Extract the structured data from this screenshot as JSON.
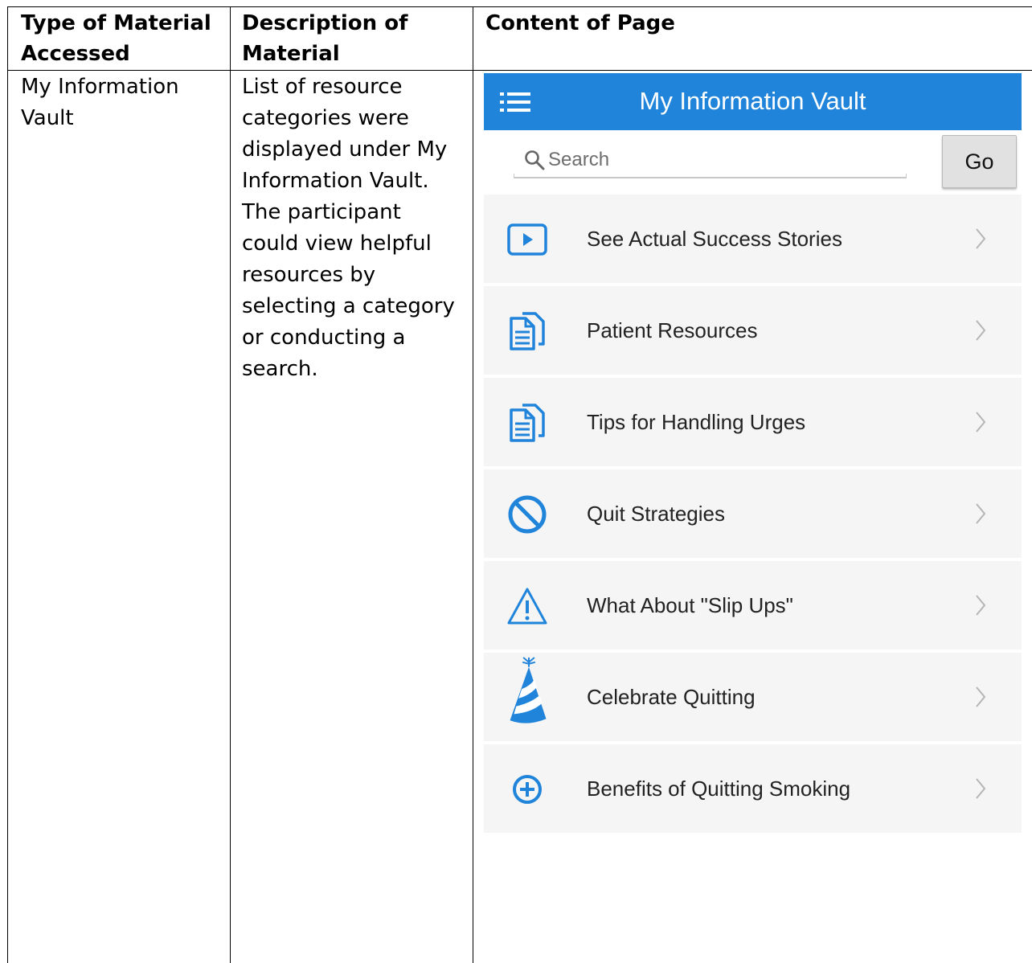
{
  "table": {
    "headers": [
      "Type of Material Accessed",
      "Description of Material",
      "Content of Page"
    ],
    "header_lines": [
      [
        "Type of Material",
        "Accessed"
      ],
      [
        "Description of",
        "Material"
      ],
      [
        "Content of Page"
      ]
    ],
    "row": {
      "type_lines": [
        "My Information",
        "Vault"
      ],
      "description_lines": [
        "List of resource",
        "categories were",
        "displayed under My",
        "Information Vault.",
        "The participant",
        "could view helpful",
        "resources by",
        "selecting a category",
        "or conducting a",
        "search."
      ]
    }
  },
  "app": {
    "title": "My Information Vault",
    "menu_icon": "hamburger-list-icon",
    "search": {
      "placeholder": "Search",
      "icon": "search-icon"
    },
    "go_label": "Go",
    "accent_color": "#2184db",
    "items": [
      {
        "label": "See Actual Success Stories",
        "icon": "play-video-icon"
      },
      {
        "label": "Patient Resources",
        "icon": "documents-icon"
      },
      {
        "label": "Tips for Handling Urges",
        "icon": "documents-icon"
      },
      {
        "label": "Quit Strategies",
        "icon": "prohibited-icon"
      },
      {
        "label": "What About \"Slip Ups\"",
        "icon": "warning-icon"
      },
      {
        "label": "Celebrate Quitting",
        "icon": "party-hat-icon"
      },
      {
        "label": "Benefits of Quitting Smoking",
        "icon": "plus-circle-icon"
      }
    ]
  }
}
